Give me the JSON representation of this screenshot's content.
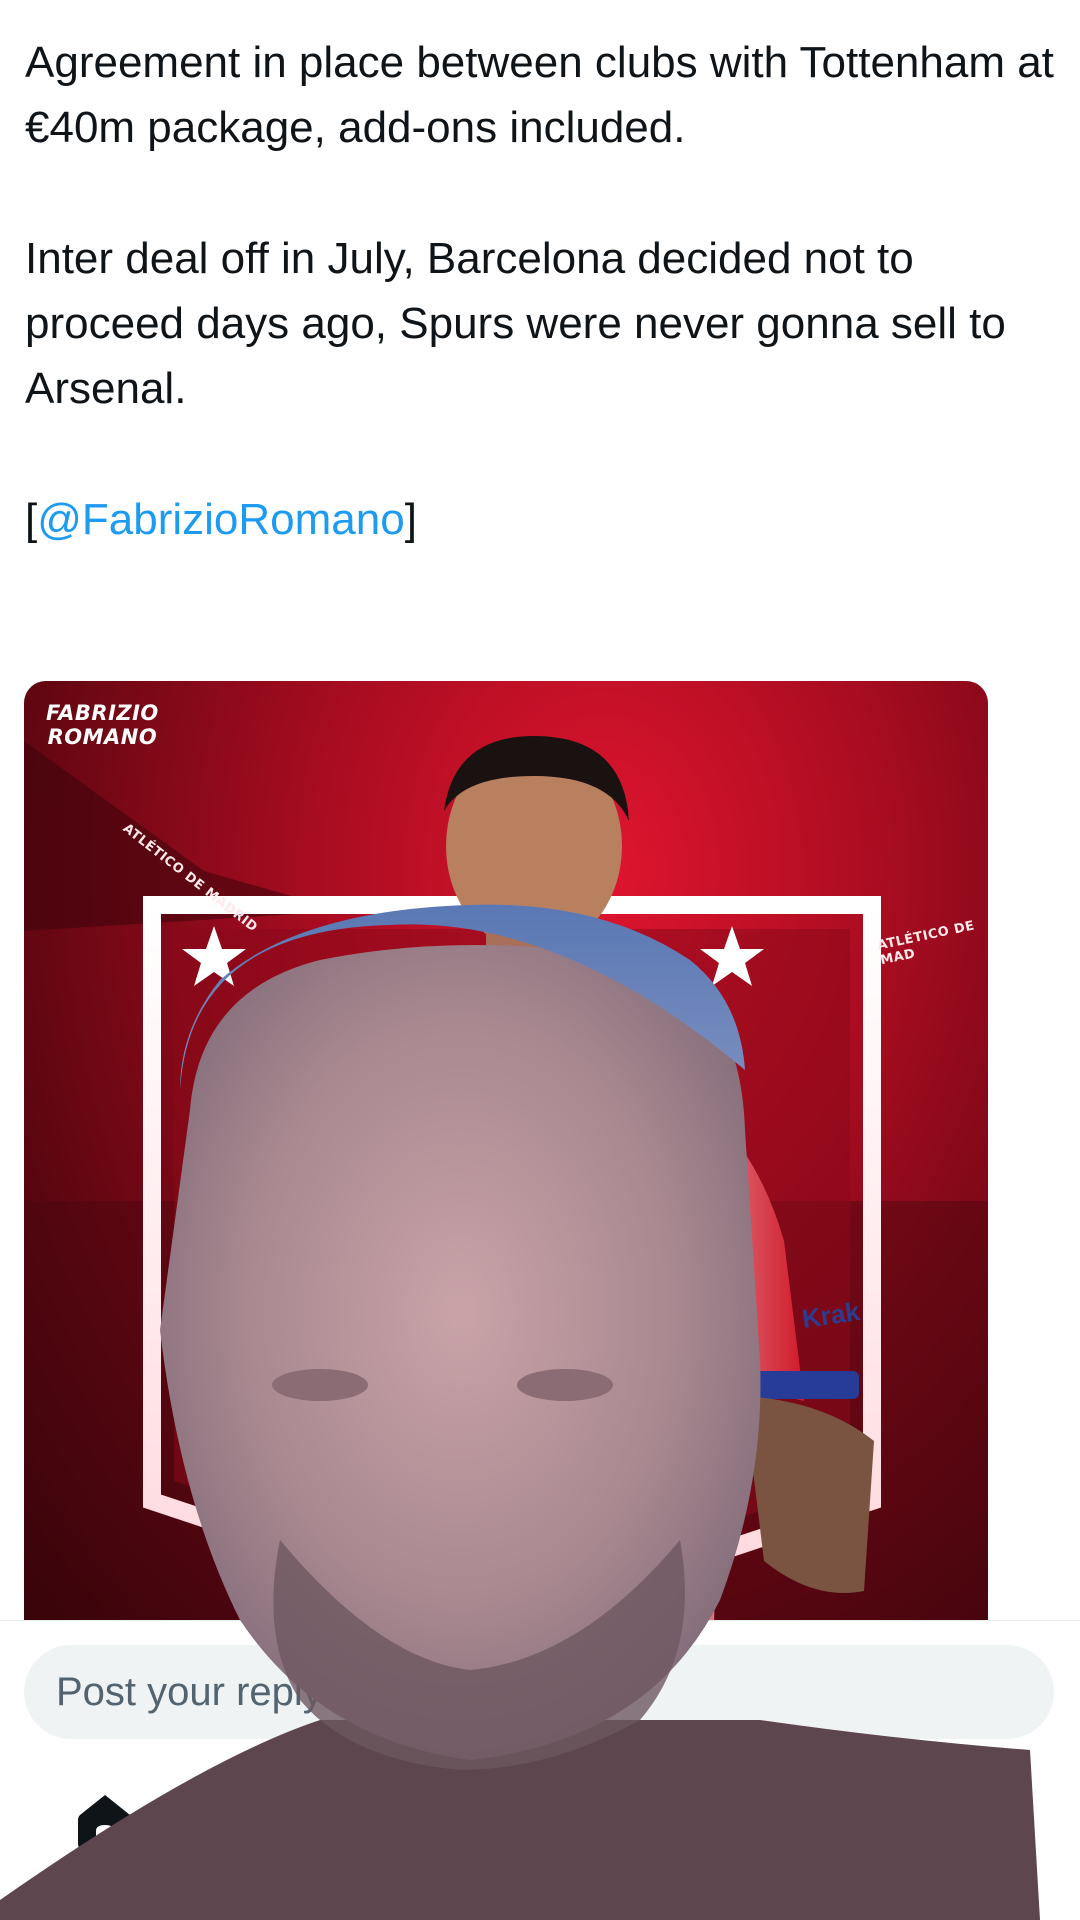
{
  "tweet": {
    "paragraph_1": "Agreement in place between clubs with Tottenham at €40m package, add-ons included.",
    "paragraph_2": "Inter deal off in July, Barcelona decided not to proceed days ago, Spurs were never gonna sell to Arsenal.",
    "source_open": "[",
    "source_mention": "@FabrizioRomano",
    "source_close": "]"
  },
  "media": {
    "watermark_line_1": "FABRIZIO",
    "watermark_line_2": "ROMANO",
    "stadium_label_left": "ATLÉTICO DE MADRID",
    "stadium_label_right": "ATLÉTICO DE MAD",
    "kit_sponsor": "Krak"
  },
  "composer": {
    "placeholder": "Post your reply"
  },
  "bottom_nav": {
    "home_icon": "home-icon"
  },
  "colors": {
    "mention": "#1d9bf0",
    "text": "#0f1419",
    "input_bg": "#eff3f4",
    "media_red": "#c8102e"
  }
}
